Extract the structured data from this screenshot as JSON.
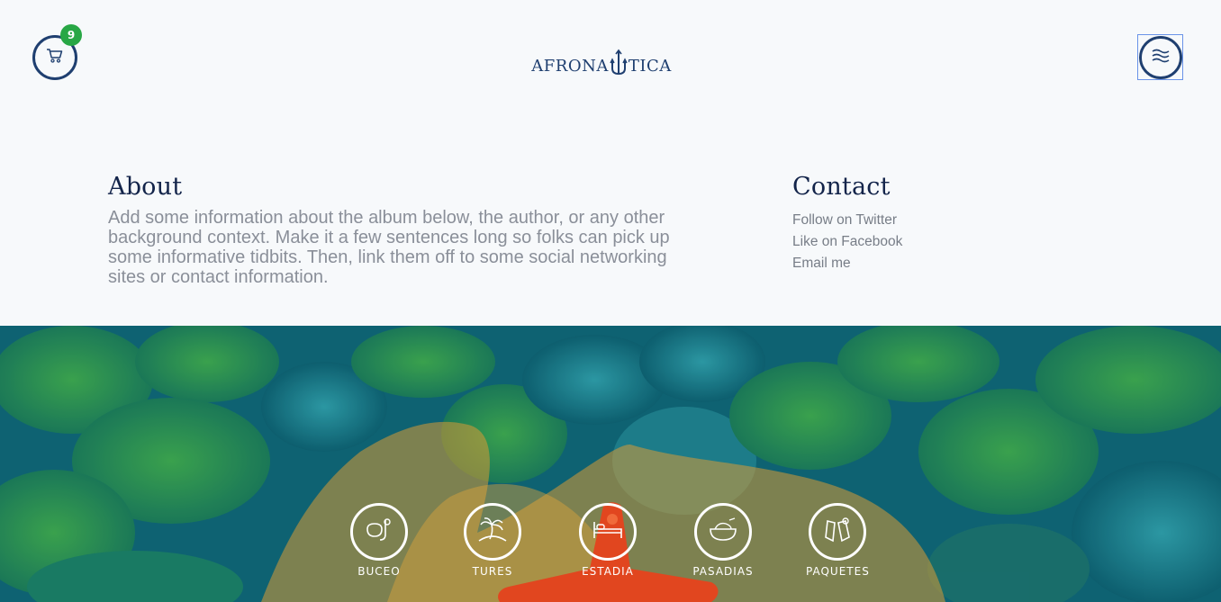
{
  "header": {
    "cart_count": "9",
    "cart_icon": "cart-icon",
    "menu_icon": "waves-menu-icon",
    "logo": {
      "part1": "AFRONA",
      "part2": "TICA",
      "trident_icon": "trident-icon"
    }
  },
  "about": {
    "heading": "About",
    "body": "Add some information about the album below, the author, or any other background context. Make it a few sentences long so folks can pick up some informative tidbits. Then, link them off to some social networking sites or contact information."
  },
  "contact": {
    "heading": "Contact",
    "links": [
      {
        "label": "Follow on Twitter"
      },
      {
        "label": "Like on Facebook"
      },
      {
        "label": "Email me"
      }
    ]
  },
  "categories": [
    {
      "label": "BUCEO",
      "icon": "snorkel-mask-icon"
    },
    {
      "label": "TURES",
      "icon": "palm-island-icon"
    },
    {
      "label": "ESTADIA",
      "icon": "bed-icon"
    },
    {
      "label": "PASADIAS",
      "icon": "food-bowl-icon"
    },
    {
      "label": "PAQUETES",
      "icon": "flippers-icon"
    }
  ],
  "colors": {
    "brand_navy": "#1f3f70",
    "badge_green": "#28a745",
    "overlay_orange": "#e0a43a"
  }
}
